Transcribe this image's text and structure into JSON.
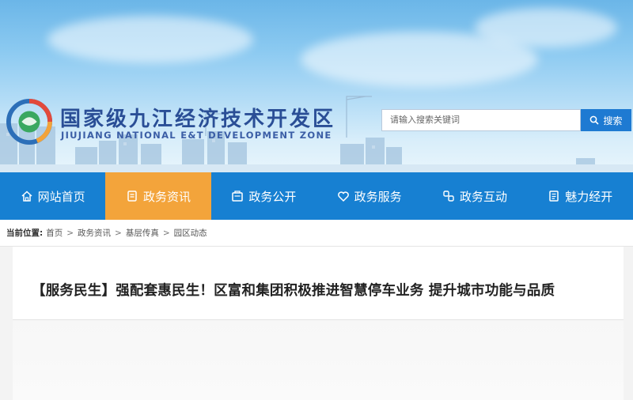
{
  "header": {
    "site_title": "国家级九江经济技术开发区",
    "site_subtitle": "JIUJIANG NATIONAL E&T DEVELOPMENT ZONE",
    "search": {
      "placeholder": "请输入搜索关键词",
      "button_label": "搜索"
    }
  },
  "nav": {
    "items": [
      {
        "label": "网站首页",
        "icon": "home-icon"
      },
      {
        "label": "政务资讯",
        "icon": "document-icon",
        "active": true
      },
      {
        "label": "政务公开",
        "icon": "folder-icon"
      },
      {
        "label": "政务服务",
        "icon": "heart-icon"
      },
      {
        "label": "政务互动",
        "icon": "interaction-icon"
      },
      {
        "label": "魅力经开",
        "icon": "book-icon"
      }
    ]
  },
  "breadcrumb": {
    "label": "当前位置:",
    "items": [
      "首页",
      "政务资讯",
      "基层传真",
      "园区动态"
    ],
    "separator": ">"
  },
  "article": {
    "title": "【服务民生】强配套惠民生！区富和集团积极推进智慧停车业务 提升城市功能与品质"
  },
  "colors": {
    "nav_bg": "#1780d2",
    "nav_active": "#f3a43b",
    "search_button": "#1e7ad2",
    "title_blue": "#2a4e96"
  }
}
